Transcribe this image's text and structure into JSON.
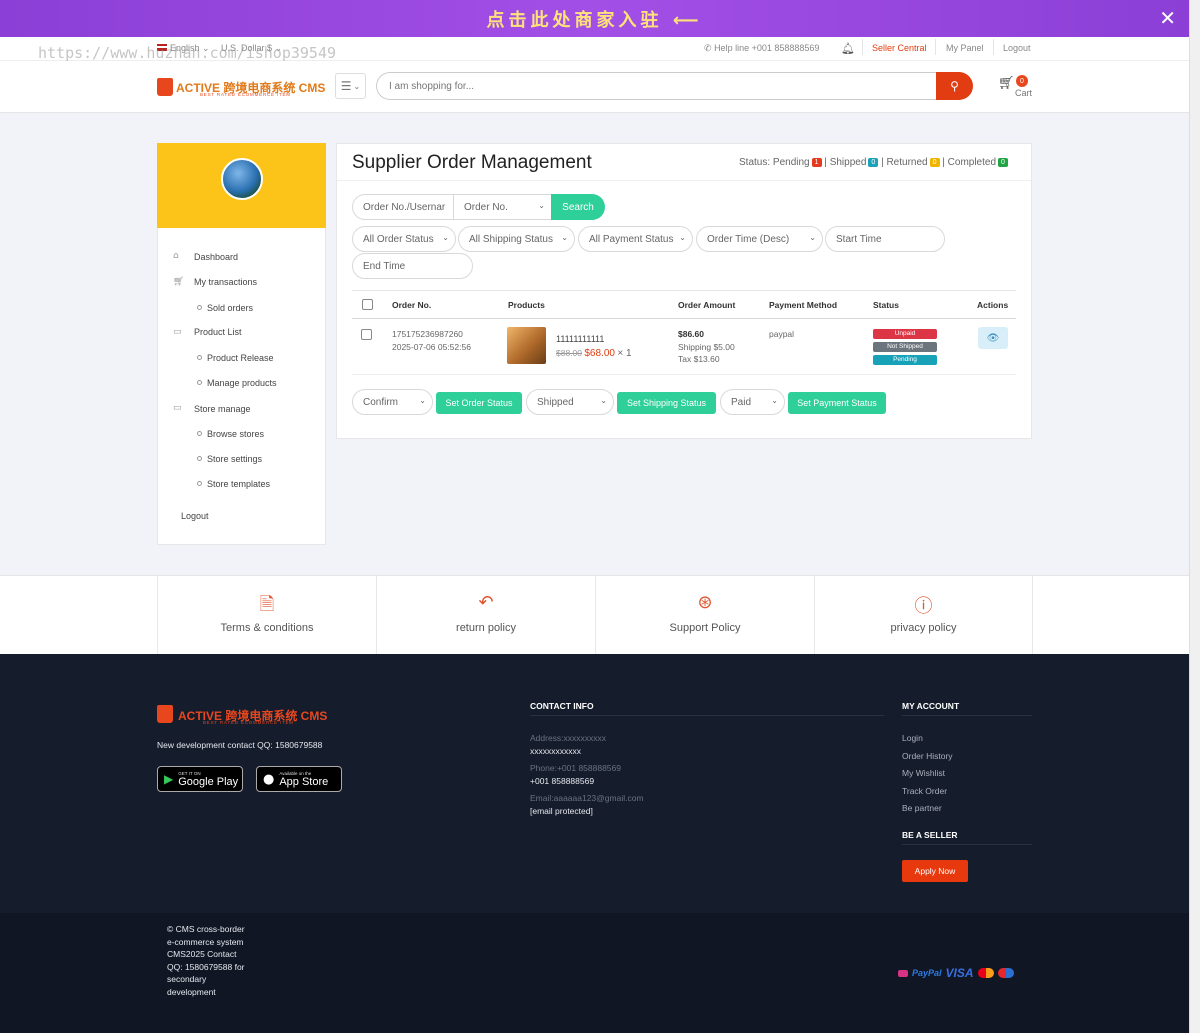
{
  "banner": {
    "text": "点击此处商家入驻 ⟵",
    "close_icon": "close-icon"
  },
  "watermark": "https://www.huzhan.com/ishop39549",
  "topbar": {
    "language": "English",
    "currency": "U.S. Dollar $",
    "helpline": "Help line +001 858888569",
    "seller_central": "Seller Central",
    "my_panel": "My Panel",
    "logout": "Logout"
  },
  "header": {
    "logo_text": "ACTIVE 跨境电商系统 CMS",
    "logo_sub": "BEST RATED ECOMMERCE ITEM",
    "search_placeholder": "I am shopping for...",
    "cart_count": "0",
    "cart_label": "Cart"
  },
  "sidebar": {
    "items": [
      {
        "label": "Dashboard",
        "icon": "home-icon"
      },
      {
        "label": "My transactions",
        "icon": "cart-icon"
      },
      {
        "label": "Sold orders",
        "icon": "dot-icon"
      },
      {
        "label": "Product List",
        "icon": "folder-icon"
      },
      {
        "label": "Product Release",
        "icon": "dot-icon"
      },
      {
        "label": "Manage products",
        "icon": "dot-icon"
      },
      {
        "label": "Store manage",
        "icon": "folder-icon"
      },
      {
        "label": "Browse stores",
        "icon": "dot-icon"
      },
      {
        "label": "Store settings",
        "icon": "dot-icon"
      },
      {
        "label": "Store templates",
        "icon": "dot-icon"
      },
      {
        "label": "Logout",
        "icon": ""
      }
    ]
  },
  "main": {
    "title": "Supplier Order Management",
    "status_prefix": "Status:",
    "statuses": [
      {
        "label": "Pending",
        "count": "1",
        "color": "#e53a1e"
      },
      {
        "label": "Shipped",
        "count": "0",
        "color": "#1ba1b8"
      },
      {
        "label": "Returned",
        "count": "0",
        "color": "#f0b400"
      },
      {
        "label": "Completed",
        "count": "0",
        "color": "#22a346"
      }
    ],
    "filters": {
      "keyword_placeholder": "Order No./Usernar",
      "search_type": "Order No.",
      "search_label": "Search",
      "order_status": "All Order Status",
      "shipping_status": "All Shipping Status",
      "payment_status": "All Payment Status",
      "order_time": "Order Time (Desc)",
      "start_time": "Start Time",
      "end_time": "End Time"
    },
    "table": {
      "headers": [
        "Order No.",
        "Products",
        "Order Amount",
        "Payment Method",
        "Status",
        "Actions"
      ],
      "rows": [
        {
          "order_no": "175175236987260",
          "date": "2025-07-06 05:52:56",
          "product_name": "11111111111",
          "old_price": "$88.00",
          "price": "$68.00",
          "qty": "× 1",
          "amount": "$86.60",
          "shipping": "Shipping $5.00",
          "tax": "Tax $13.60",
          "payment_method": "paypal",
          "status_unpaid": "Unpaid",
          "status_not_shipped": "Not Shipped",
          "status_pending": "Pending"
        }
      ]
    },
    "bulk": {
      "order_status_value": "Confirm",
      "set_order_status": "Set Order Status",
      "shipping_value": "Shipped",
      "set_shipping_status": "Set Shipping Status",
      "payment_value": "Paid",
      "set_payment_status": "Set Payment Status"
    }
  },
  "policies": [
    {
      "label": "Terms & conditions",
      "icon": "document-icon"
    },
    {
      "label": "return policy",
      "icon": "return-arrow-icon"
    },
    {
      "label": "Support Policy",
      "icon": "lifebuoy-icon"
    },
    {
      "label": "privacy policy",
      "icon": "alert-circle-icon"
    }
  ],
  "footer": {
    "contact_qq": "New development contact QQ: 1580679588",
    "google_play_small": "GET IT ON",
    "google_play_big": "Google Play",
    "app_store_small": "Available on the",
    "app_store_big": "App Store",
    "contact_info_title": "CONTACT INFO",
    "address_label": "Address:xxxxxxxxxx",
    "address_value": "xxxxxxxxxxxx",
    "phone_label": "Phone:+001 858888569",
    "phone_value": "+001 858888569",
    "email_label": "Email:aaaaaa123@gmail.com",
    "email_value": "[email protected]",
    "my_account_title": "MY ACCOUNT",
    "account_links": [
      "Login",
      "Order History",
      "My Wishlist",
      "Track Order",
      "Be partner"
    ],
    "be_seller_title": "BE A SELLER",
    "apply_now": "Apply Now",
    "copyright": "© CMS cross-border e-commerce system CMS2025 Contact QQ: 1580679588 for secondary development",
    "payment_logos": [
      "PayPal",
      "VISA"
    ]
  },
  "colors": {
    "accent_red": "#e13c12",
    "green_button": "#2fcf9a",
    "sidebar_header": "#fcc419",
    "banner_purple": "#9a47e0",
    "footer_bg": "#151c2b"
  }
}
